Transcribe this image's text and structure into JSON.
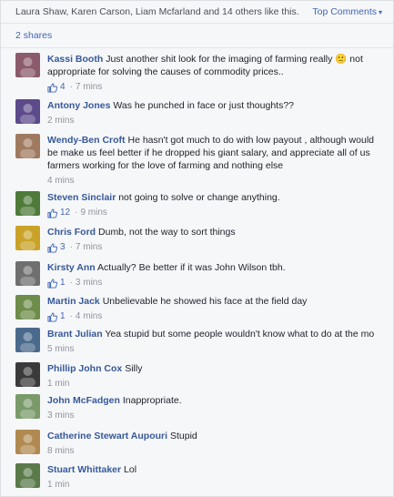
{
  "header": {
    "likes_text": "Laura Shaw, Karen Carson, Liam Mcfarland and 14 others like this.",
    "top_comments_label": "Top Comments"
  },
  "shares": {
    "label": "2 shares"
  },
  "comments": [
    {
      "author": "Kassi Booth",
      "text": "Just another shit look for the imaging of farming really 🙁 not appropriate for solving the causes of commodity prices..",
      "likes": "4",
      "time": "7 mins",
      "avatar_color": "#8b5a6b"
    },
    {
      "author": "Antony Jones",
      "text": "Was he punched in face or just thoughts??",
      "likes": "",
      "time": "2 mins",
      "avatar_color": "#5c4a8a"
    },
    {
      "author": "Wendy-Ben Croft",
      "text": "He hasn't got much to do with low payout , although would be make us feel better if he dropped his giant salary, and appreciate all of us farmers working for the love of farming and nothing else",
      "likes": "",
      "time": "4 mins",
      "avatar_color": "#a07a60"
    },
    {
      "author": "Steven Sinclair",
      "text": "not going to solve or change anything.",
      "likes": "12",
      "time": "9 mins",
      "avatar_color": "#4e7a3a"
    },
    {
      "author": "Chris Ford",
      "text": "Dumb, not the way to sort things",
      "likes": "3",
      "time": "7 mins",
      "avatar_color": "#c9a227"
    },
    {
      "author": "Kirsty Ann",
      "text": "Actually? Be better if it was John Wilson tbh.",
      "likes": "1",
      "time": "3 mins",
      "avatar_color": "#6f6f6f"
    },
    {
      "author": "Martin Jack",
      "text": "Unbelievable he showed his face at the field day",
      "likes": "1",
      "time": "4 mins",
      "avatar_color": "#6e8c4a"
    },
    {
      "author": "Brant Julian",
      "text": "Yea stupid but some people wouldn't know what to do at the mo",
      "likes": "",
      "time": "5 mins",
      "avatar_color": "#4a6a8c"
    },
    {
      "author": "Phillip John Cox",
      "text": "Silly",
      "likes": "",
      "time": "1 min",
      "avatar_color": "#3a3a3a"
    },
    {
      "author": "John McFadgen",
      "text": "Inappropriate.",
      "likes": "",
      "time": "3 mins",
      "avatar_color": "#7a9a6a"
    },
    {
      "author": "Catherine Stewart Aupouri",
      "text": "Stupid",
      "likes": "",
      "time": "8 mins",
      "avatar_color": "#b08a50"
    },
    {
      "author": "Stuart Whittaker",
      "text": "Lol",
      "likes": "",
      "time": "1 min",
      "avatar_color": "#5a7a4a"
    }
  ]
}
